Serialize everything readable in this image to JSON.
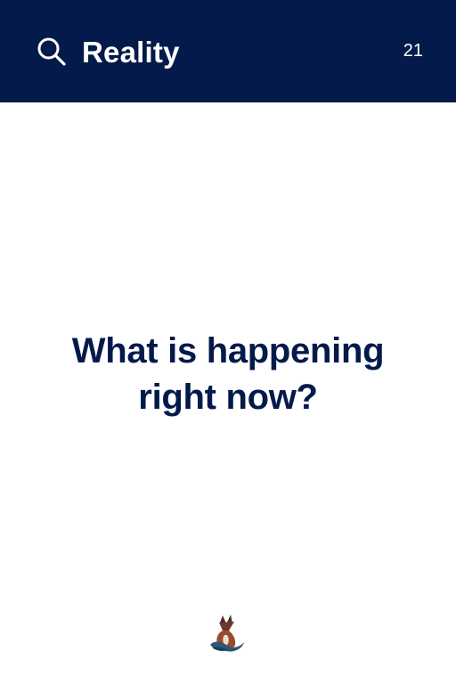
{
  "header": {
    "title": "Reality",
    "count": "21",
    "search_icon": "search-icon",
    "background_color": "#031a4a"
  },
  "card": {
    "question": "What is happening right now?",
    "text_color": "#031a4a"
  },
  "footer": {
    "logo_icon": "fox-logo-icon"
  }
}
